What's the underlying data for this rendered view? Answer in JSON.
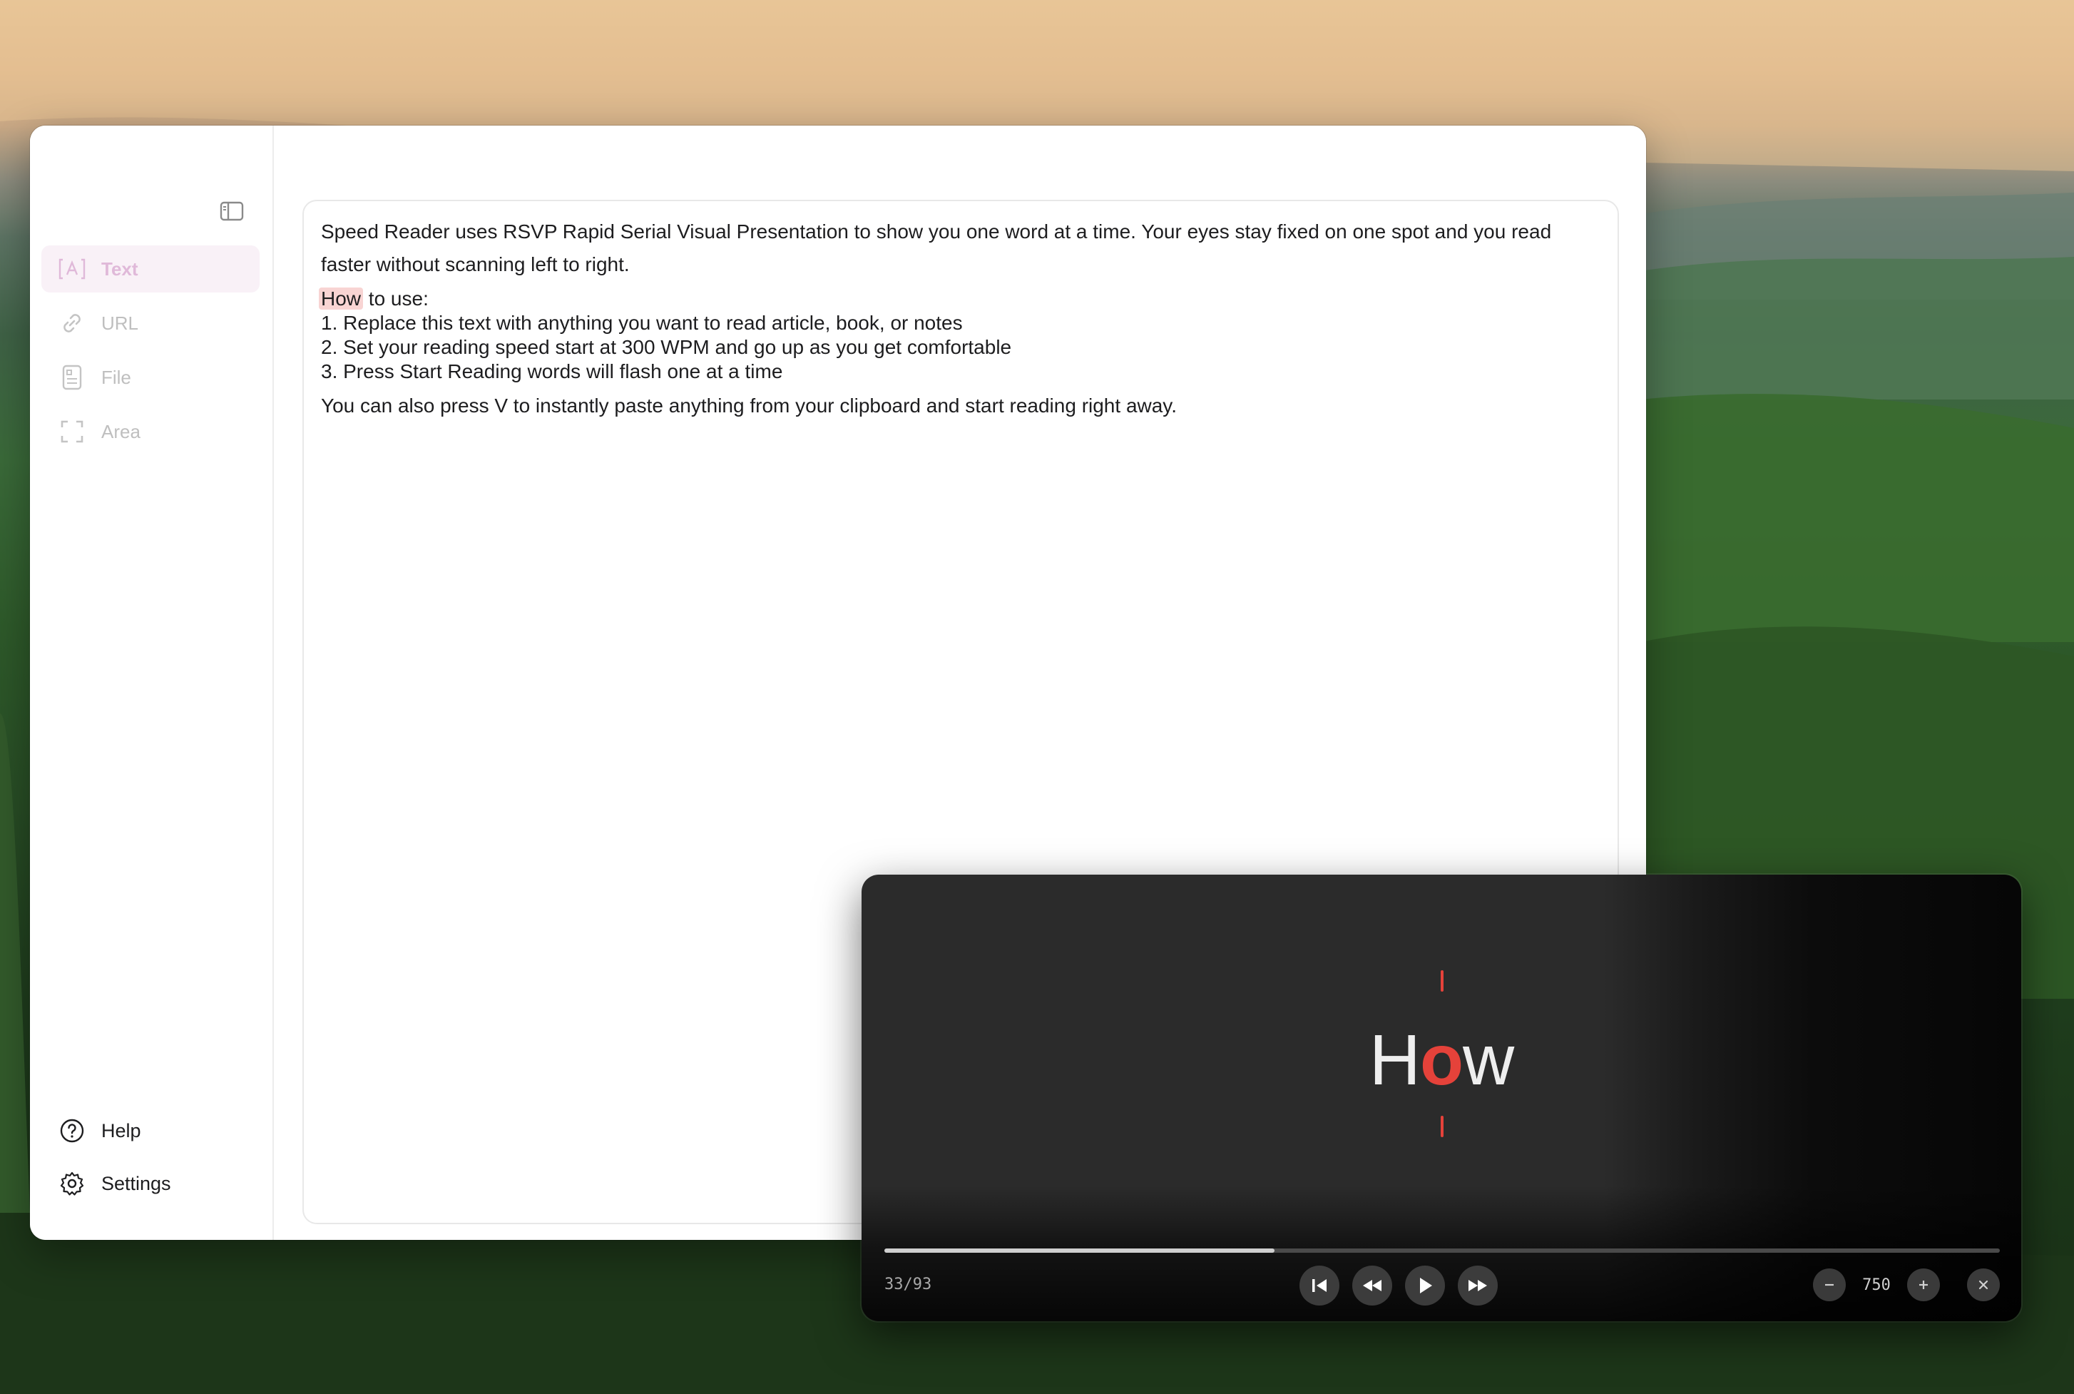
{
  "window": {
    "title": ""
  },
  "sidebar": {
    "items": [
      {
        "label": "Text",
        "icon": "text-input-icon",
        "active": true
      },
      {
        "label": "URL",
        "icon": "link-icon",
        "active": false
      },
      {
        "label": "File",
        "icon": "document-icon",
        "active": false
      },
      {
        "label": "Area",
        "icon": "screen-capture-icon",
        "active": false
      }
    ],
    "bottom": [
      {
        "label": "Help",
        "icon": "question-circle-icon"
      },
      {
        "label": "Settings",
        "icon": "gear-icon"
      }
    ]
  },
  "editor": {
    "paragraph1": "Speed Reader uses RSVP Rapid Serial Visual Presentation to show you one word at a time. Your eyes stay fixed on one spot and you read faster without scanning left to right.",
    "highlight_word": "How",
    "line2_rest": " to use:",
    "step1": "1. Replace this text with anything you want to read article, book, or notes",
    "step2": "2. Set your reading speed start at 300 WPM and go up as you get comfortable",
    "step3": "3. Press Start Reading words will flash one at a time",
    "paragraph3": "You can also press V to instantly paste anything from your clipboard and start reading right away."
  },
  "reader": {
    "word_pre": "H",
    "word_orp": "o",
    "word_post": "w",
    "counter": "33/93",
    "progress": 0.35,
    "wpm": "750",
    "colors": {
      "accent": "#e5423a",
      "background": "#2b2b2b"
    }
  }
}
